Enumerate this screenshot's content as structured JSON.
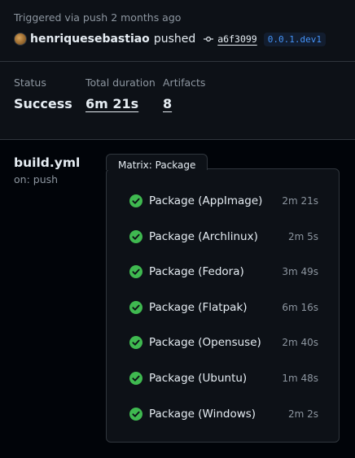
{
  "summary": {
    "trigger_text": "Triggered via push 2 months ago",
    "username": "henriquesebastiao",
    "action": "pushed",
    "commit_sha": "a6f3099",
    "tag": "0.0.1.dev1",
    "status_label": "Status",
    "status_value": "Success",
    "duration_label": "Total duration",
    "duration_value": "6m 21s",
    "artifacts_label": "Artifacts",
    "artifacts_value": "8"
  },
  "workflow": {
    "file": "build.yml",
    "trigger": "on: push"
  },
  "matrix": {
    "title": "Matrix: Package",
    "jobs": [
      {
        "name": "Package (AppImage)",
        "duration": "2m 21s",
        "status": "success"
      },
      {
        "name": "Package (Archlinux)",
        "duration": "2m 5s",
        "status": "success"
      },
      {
        "name": "Package (Fedora)",
        "duration": "3m 49s",
        "status": "success"
      },
      {
        "name": "Package (Flatpak)",
        "duration": "6m 16s",
        "status": "success"
      },
      {
        "name": "Package (Opensuse)",
        "duration": "2m 40s",
        "status": "success"
      },
      {
        "name": "Package (Ubuntu)",
        "duration": "1m 48s",
        "status": "success"
      },
      {
        "name": "Package (Windows)",
        "duration": "2m 2s",
        "status": "success"
      }
    ]
  },
  "icons": {
    "job_status": "check-circle-fill-icon",
    "commit": "git-commit-icon"
  },
  "colors": {
    "success": "#3fb950",
    "link": "#4493f8",
    "muted": "#8d96a0",
    "background": "#010409",
    "panel": "#0d1117",
    "border": "#30363d"
  }
}
